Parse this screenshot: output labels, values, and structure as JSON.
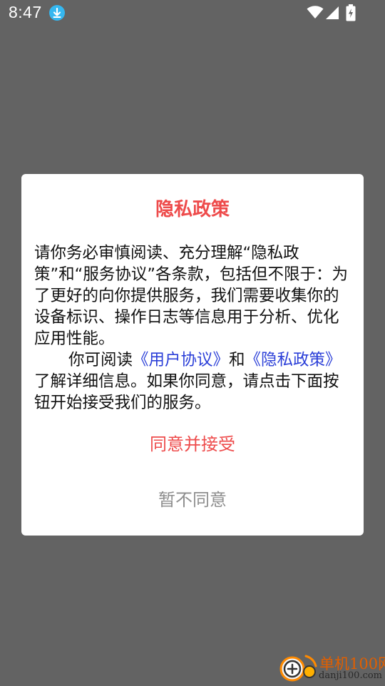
{
  "status_bar": {
    "time": "8:47",
    "icons": [
      "download-icon",
      "wifi-icon",
      "signal-icon",
      "battery-charging-icon"
    ]
  },
  "dialog": {
    "title": "隐私政策",
    "paragraph1": "请你务必审慎阅读、充分理解“隐私政策”和“服务协议”各条款，包括但不限于：为了更好的向你提供服务，我们需要收集你的设备标识、操作日志等信息用于分析、优化应用性能。",
    "paragraph2_prefix": "你可阅读",
    "user_agreement_link": "《用户协议》",
    "paragraph2_middle": "和",
    "privacy_policy_link": "《隐私政策》",
    "paragraph2_suffix": "了解详细信息。如果你同意，请点击下面按钮开始接受我们的服务。",
    "accept_label": "同意并接受",
    "decline_label": "暂不同意"
  },
  "watermark": {
    "main": "单机100网",
    "sub": "danji100.com"
  },
  "colors": {
    "overlay": "#636363",
    "accent_red": "#ee4b4b",
    "link_blue": "#2b3fd8",
    "decline_gray": "#8e8e8e",
    "download_badge": "#35b7f0"
  }
}
